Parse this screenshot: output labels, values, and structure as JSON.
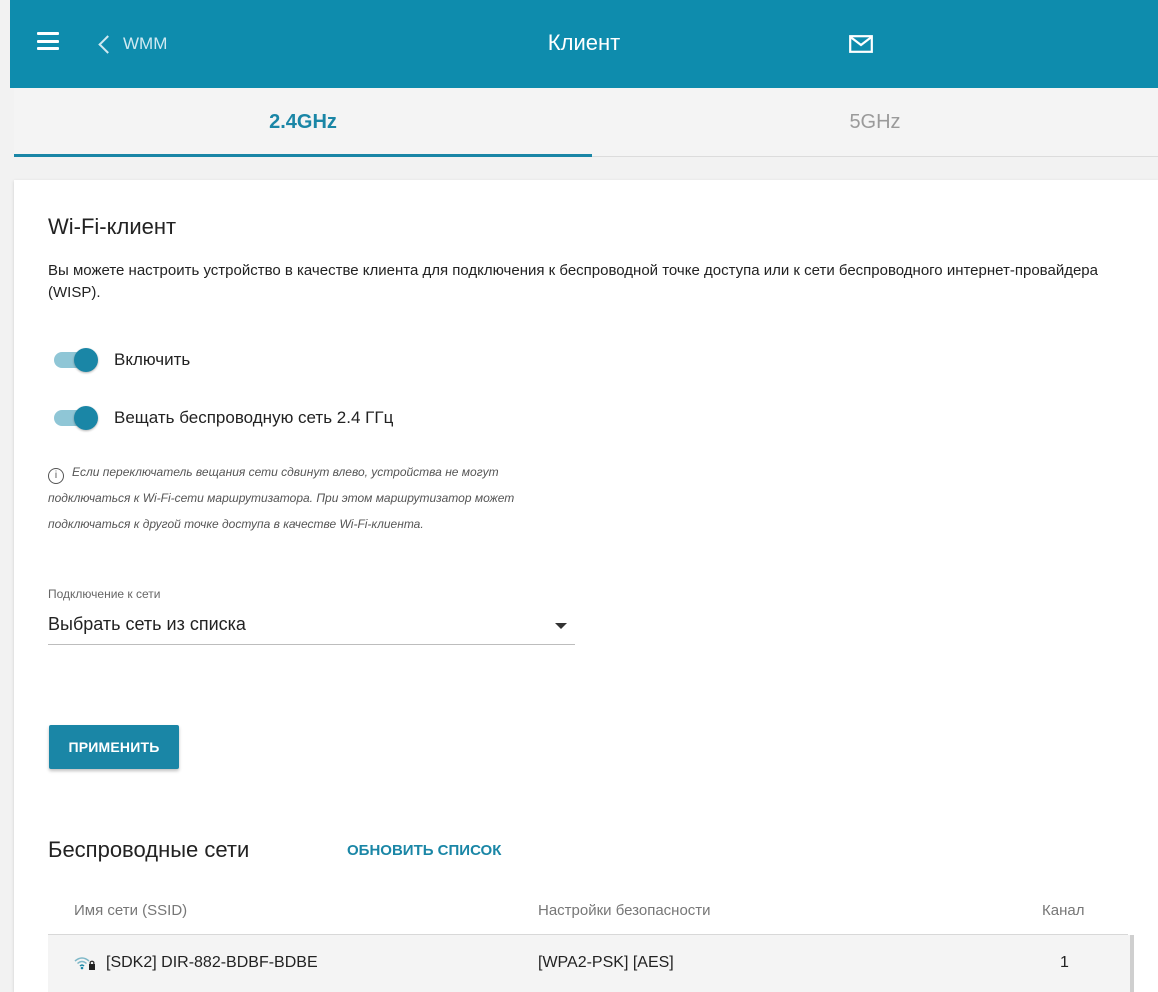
{
  "header": {
    "back_label": "WMM",
    "title": "Клиент"
  },
  "tabs": [
    {
      "label": "2.4GHz",
      "active": true
    },
    {
      "label": "5GHz",
      "active": false
    }
  ],
  "section": {
    "title": "Wi-Fi-клиент",
    "description": "Вы можете настроить устройство в качестве клиента для подключения к беспроводной точке доступа или к сети беспроводного интернет-провайдера (WISP)."
  },
  "toggles": [
    {
      "label": "Включить",
      "on": true
    },
    {
      "label": "Вещать беспроводную сеть 2.4 ГГц",
      "on": true
    }
  ],
  "hint": {
    "icon": "info-icon",
    "text": "Если переключатель вещания сети сдвинут влево, устройства не могут подключаться к Wi-Fi-сети маршрутизатора. При этом маршрутизатор может подключаться к другой точке доступа в качестве Wi-Fi-клиента."
  },
  "connection": {
    "label": "Подключение к сети",
    "value": "Выбрать сеть из списка"
  },
  "apply_label": "ПРИМЕНИТЬ",
  "networks": {
    "title": "Беспроводные сети",
    "refresh_label": "ОБНОВИТЬ СПИСОК",
    "columns": [
      "Имя сети (SSID)",
      "Настройки безопасности",
      "Канал"
    ],
    "rows": [
      {
        "ssid": "[SDK2] DIR-882-BDBF-BDBE",
        "security": "[WPA2-PSK] [AES]",
        "channel": "1"
      }
    ]
  },
  "colors": {
    "accent": "#1a86a6",
    "header_bg": "#0e8cad"
  }
}
